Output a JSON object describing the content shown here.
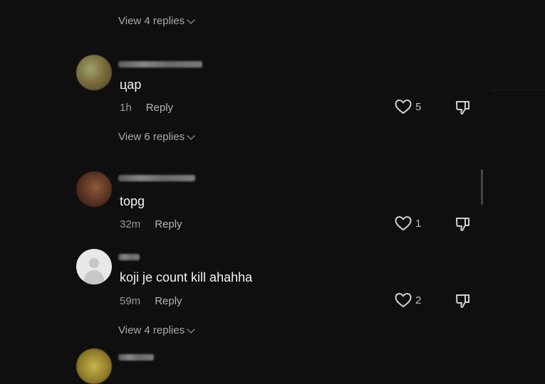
{
  "threads": [
    {
      "view_replies": "View 4 replies"
    },
    {
      "comment": "цар",
      "time": "1h",
      "reply_label": "Reply",
      "likes": "5",
      "view_replies": "View 6 replies"
    },
    {
      "comment": "topg",
      "time": "32m",
      "reply_label": "Reply",
      "likes": "1"
    },
    {
      "comment": "koji je count kill ahahha",
      "time": "59m",
      "reply_label": "Reply",
      "likes": "2",
      "view_replies": "View 4 replies"
    }
  ],
  "icons": {
    "like": "heart-outline-icon",
    "dislike": "thumbs-down-outline-icon",
    "expand": "chevron-down-icon"
  },
  "colors": {
    "background": "#0f0f0f",
    "text_primary": "#f2f2f2",
    "text_secondary": "#a9a9a9"
  }
}
